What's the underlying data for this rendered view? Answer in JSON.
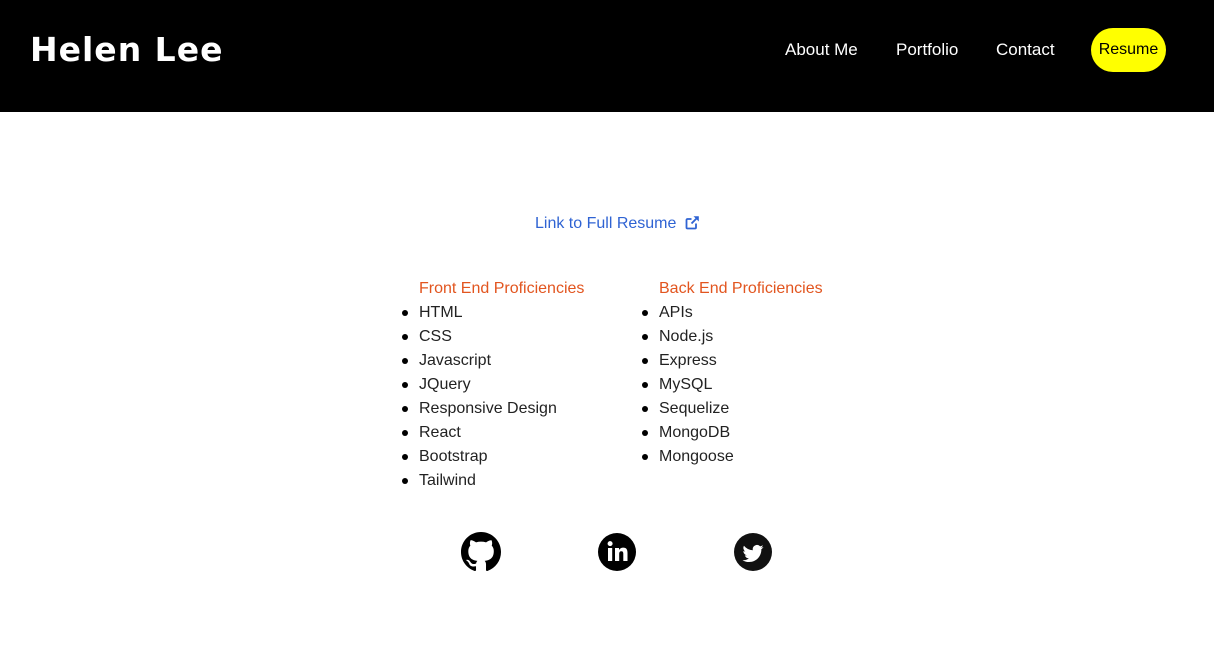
{
  "header": {
    "brand": "Helen Lee",
    "nav": {
      "about": "About Me",
      "portfolio": "Portfolio",
      "contact": "Contact"
    },
    "resume_button": "Resume"
  },
  "main": {
    "resume_link": "Link to Full Resume",
    "front_end": {
      "heading": "Front End Proficiencies",
      "items": [
        "HTML",
        "CSS",
        "Javascript",
        "JQuery",
        "Responsive Design",
        "React",
        "Bootstrap",
        "Tailwind"
      ]
    },
    "back_end": {
      "heading": "Back End Proficiencies",
      "items": [
        "APIs",
        "Node.js",
        "Express",
        "MySQL",
        "Sequelize",
        "MongoDB",
        "Mongoose"
      ]
    }
  },
  "social": {
    "icons": [
      "github-icon",
      "linkedin-icon",
      "twitter-icon"
    ]
  },
  "colors": {
    "nav_background": "#000000",
    "resume_button": "#ffff00",
    "link": "#2f63d3",
    "heading_accent": "#e2551f"
  }
}
